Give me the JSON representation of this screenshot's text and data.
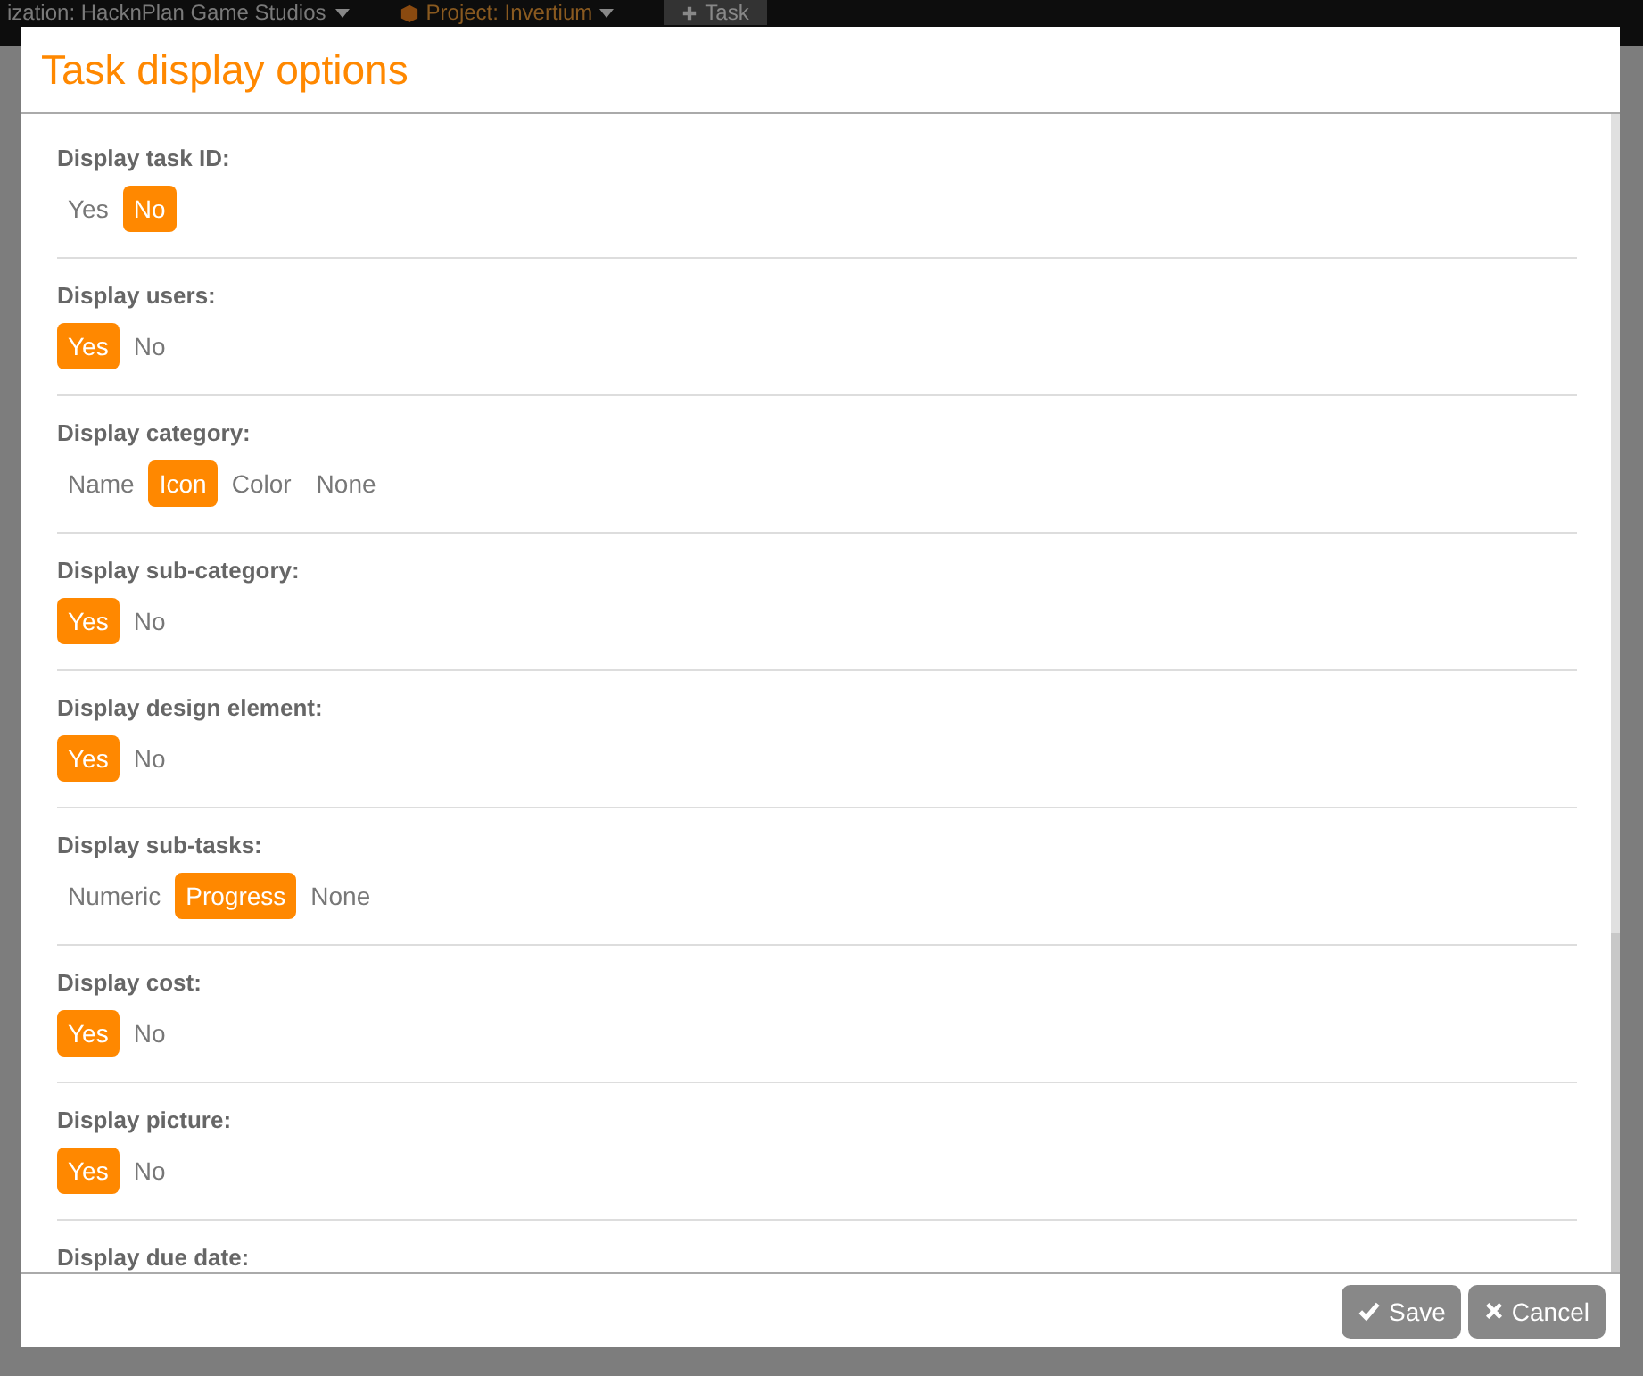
{
  "topbar": {
    "organization": "ization: HacknPlan Game Studios",
    "project": "Project: Invertium",
    "task_button": "Task"
  },
  "dialog": {
    "title": "Task display options",
    "groups": [
      {
        "label": "Display task ID:",
        "options": [
          {
            "label": "Yes",
            "selected": false
          },
          {
            "label": "No",
            "selected": true
          }
        ]
      },
      {
        "label": "Display users:",
        "options": [
          {
            "label": "Yes",
            "selected": true
          },
          {
            "label": "No",
            "selected": false
          }
        ]
      },
      {
        "label": "Display category:",
        "options": [
          {
            "label": "Name",
            "selected": false
          },
          {
            "label": "Icon",
            "selected": true
          },
          {
            "label": "Color",
            "selected": false
          },
          {
            "label": "None",
            "selected": false
          }
        ]
      },
      {
        "label": "Display sub-category:",
        "options": [
          {
            "label": "Yes",
            "selected": true
          },
          {
            "label": "No",
            "selected": false
          }
        ]
      },
      {
        "label": "Display design element:",
        "options": [
          {
            "label": "Yes",
            "selected": true
          },
          {
            "label": "No",
            "selected": false
          }
        ]
      },
      {
        "label": "Display sub-tasks:",
        "options": [
          {
            "label": "Numeric",
            "selected": false
          },
          {
            "label": "Progress",
            "selected": true
          },
          {
            "label": "None",
            "selected": false
          }
        ]
      },
      {
        "label": "Display cost:",
        "options": [
          {
            "label": "Yes",
            "selected": true
          },
          {
            "label": "No",
            "selected": false
          }
        ]
      },
      {
        "label": "Display picture:",
        "options": [
          {
            "label": "Yes",
            "selected": true
          },
          {
            "label": "No",
            "selected": false
          }
        ]
      },
      {
        "label": "Display due date:"
      }
    ],
    "buttons": [
      {
        "kind": "save",
        "label": "Save"
      },
      {
        "kind": "cancel",
        "label": "Cancel"
      }
    ]
  }
}
